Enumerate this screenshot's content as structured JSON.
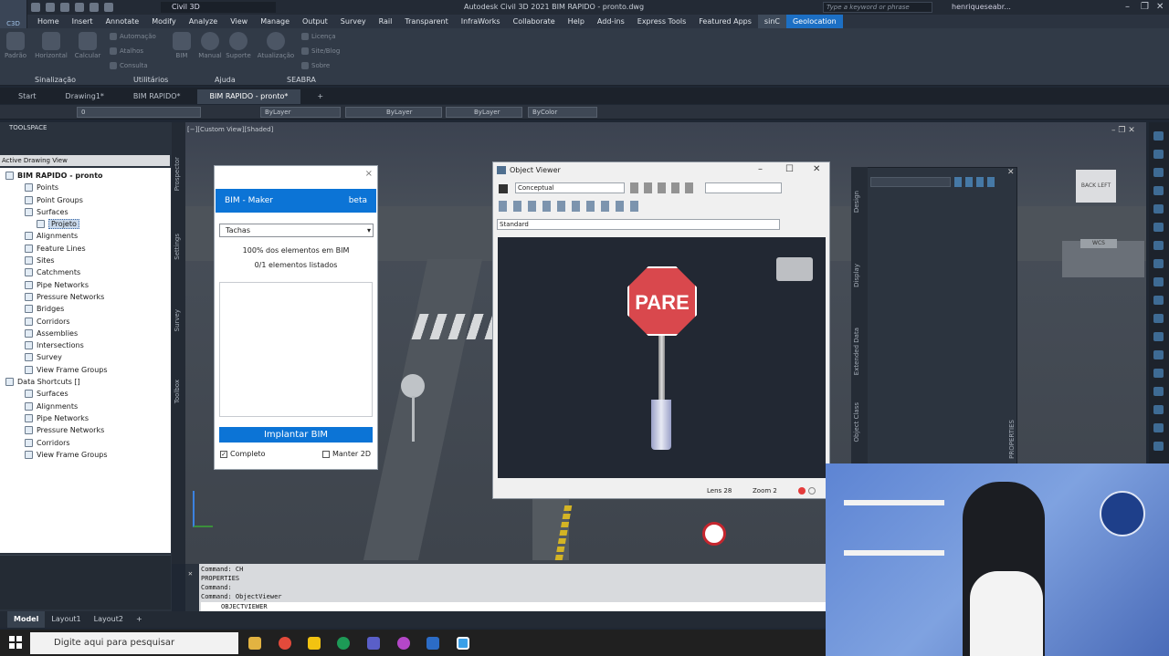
{
  "title_bar": {
    "workspace": "Civil 3D",
    "title": "Autodesk Civil 3D 2021   BIM RAPIDO - pronto.dwg",
    "search_placeholder": "Type a keyword or phrase",
    "user": "henriqueseabr...",
    "logo": "C3D"
  },
  "menu": [
    "Home",
    "Insert",
    "Annotate",
    "Modify",
    "Analyze",
    "View",
    "Manage",
    "Output",
    "Survey",
    "Rail",
    "Transparent",
    "InfraWorks",
    "Collaborate",
    "Help",
    "Add-ins",
    "Express Tools",
    "Featured Apps",
    "sinC",
    "Geolocation"
  ],
  "ribbon": {
    "buttons": [
      "Padrão",
      "Horizontal",
      "Calcular",
      "BIM",
      "Manual",
      "Suporte",
      "Atualização"
    ],
    "small": [
      "Automação",
      "Atalhos",
      "Consulta",
      "Licença",
      "Site/Blog",
      "Sobre"
    ],
    "panels": [
      "Sinalização",
      "Utilitários",
      "Ajuda",
      "SEABRA"
    ]
  },
  "doc_tabs": [
    "Start",
    "Drawing1*",
    "BIM RAPIDO*",
    "BIM RAPIDO - pronto*"
  ],
  "layer_bar": {
    "layer": "0",
    "linetype1": "ByLayer",
    "linetype2": "ByLayer",
    "lineweight": "ByLayer",
    "color": "ByColor"
  },
  "toolspace": {
    "title": "TOOLSPACE",
    "view": "Active Drawing View",
    "tree": [
      {
        "label": "BIM RAPIDO - pronto",
        "level": 0,
        "bold": true
      },
      {
        "label": "Points",
        "level": 1
      },
      {
        "label": "Point Groups",
        "level": 1
      },
      {
        "label": "Surfaces",
        "level": 1
      },
      {
        "label": "Projeto",
        "level": 2,
        "selected": true
      },
      {
        "label": "Alignments",
        "level": 1
      },
      {
        "label": "Feature Lines",
        "level": 1
      },
      {
        "label": "Sites",
        "level": 1
      },
      {
        "label": "Catchments",
        "level": 1
      },
      {
        "label": "Pipe Networks",
        "level": 1
      },
      {
        "label": "Pressure Networks",
        "level": 1
      },
      {
        "label": "Bridges",
        "level": 1
      },
      {
        "label": "Corridors",
        "level": 1
      },
      {
        "label": "Assemblies",
        "level": 1
      },
      {
        "label": "Intersections",
        "level": 1
      },
      {
        "label": "Survey",
        "level": 1
      },
      {
        "label": "View Frame Groups",
        "level": 1
      },
      {
        "label": "Data Shortcuts []",
        "level": 0
      },
      {
        "label": "Surfaces",
        "level": 1
      },
      {
        "label": "Alignments",
        "level": 1
      },
      {
        "label": "Pipe Networks",
        "level": 1
      },
      {
        "label": "Pressure Networks",
        "level": 1
      },
      {
        "label": "Corridors",
        "level": 1
      },
      {
        "label": "View Frame Groups",
        "level": 1
      }
    ],
    "side_tabs": [
      "Prospector",
      "Settings",
      "Survey",
      "Toolbox"
    ]
  },
  "viewport": {
    "label": "[−][Custom View][Shaded]"
  },
  "bim_maker": {
    "header": "BIM - Maker",
    "beta": "beta",
    "select": "Tachas",
    "status1": "100% dos elementos em BIM",
    "status2": "0/1 elementos listados",
    "button": "Implantar BIM",
    "check_full": "Completo",
    "check_2d": "Manter 2D"
  },
  "object_viewer": {
    "title": "Object Viewer",
    "visual_style": "Conceptual",
    "view": "Standard",
    "sign_text": "PARE",
    "lens": "Lens 28",
    "zoom": "Zoom 2"
  },
  "properties": {
    "tabs": [
      "Design",
      "Display",
      "Extended Data",
      "Object Class"
    ],
    "title": "PROPERTIES"
  },
  "command": {
    "history": [
      "Command: CH",
      "PROPERTIES",
      "Command:",
      "Command: ObjectViewer"
    ],
    "input": "OBJECTVIEWER"
  },
  "layout_tabs": [
    "Model",
    "Layout1",
    "Layout2"
  ],
  "taskbar": {
    "search": "Digite aqui para pesquisar"
  },
  "colors": {
    "accent": "#0c74d6",
    "sign_red": "#d9484d",
    "bg": "#1f2733"
  }
}
